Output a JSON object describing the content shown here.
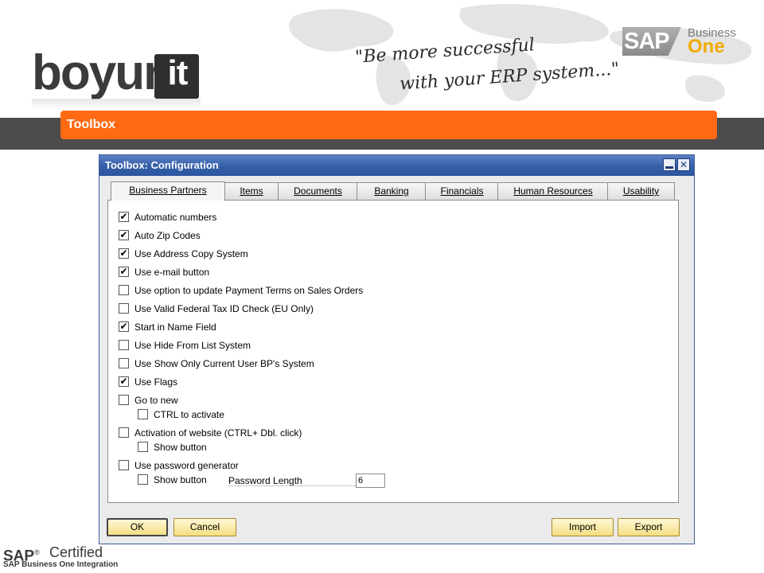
{
  "header": {
    "logo_word": "boyum",
    "logo_box": "it",
    "tagline_line1": "\"Be more successful",
    "tagline_line2": "with your ERP system...\"",
    "sap_badge": "SAP",
    "sap_business": "Business",
    "sap_one": "One"
  },
  "banner": {
    "title": "Toolbox"
  },
  "dialog": {
    "title": "Toolbox: Configuration",
    "tabs": [
      {
        "label": "Business Partners",
        "active": true
      },
      {
        "label": "Items",
        "active": false
      },
      {
        "label": "Documents",
        "active": false
      },
      {
        "label": "Banking",
        "active": false
      },
      {
        "label": "Financials",
        "active": false
      },
      {
        "label": "Human Resources",
        "active": false
      },
      {
        "label": "Usability",
        "active": false
      }
    ],
    "options": [
      {
        "label": "Automatic numbers",
        "checked": true
      },
      {
        "label": "Auto Zip Codes",
        "checked": true
      },
      {
        "label": "Use Address Copy System",
        "checked": true
      },
      {
        "label": "Use e-mail button",
        "checked": true
      },
      {
        "label": "Use option to update Payment Terms on Sales Orders",
        "checked": false
      },
      {
        "label": "Use Valid Federal Tax ID Check (EU Only)",
        "checked": false
      },
      {
        "label": "Start in Name Field",
        "checked": true
      },
      {
        "label": "Use Hide From List System",
        "checked": false
      },
      {
        "label": "Use Show Only Current User BP's System",
        "checked": false
      },
      {
        "label": "Use Flags",
        "checked": true
      },
      {
        "label": "Go to new",
        "checked": false
      },
      {
        "label": "CTRL to activate",
        "checked": false
      },
      {
        "label": "Activation of website (CTRL+ Dbl. click)",
        "checked": false
      },
      {
        "label": "Show button",
        "checked": false
      },
      {
        "label": "Use password generator",
        "checked": false
      },
      {
        "label": "Show button",
        "checked": false
      }
    ],
    "password_length": {
      "label": "Password Length",
      "value": "6"
    },
    "buttons": {
      "ok": "OK",
      "cancel": "Cancel",
      "import": "Import",
      "export": "Export"
    }
  },
  "footer": {
    "sap": "SAP",
    "reg": "®",
    "certified": "Certified",
    "sub": "SAP Business One Integration"
  },
  "colors": {
    "orange": "#ff6a13",
    "titlebar": "#355ea8",
    "button": "#f4de83"
  },
  "icons": {
    "minimize": "minimize-icon",
    "close": "close-icon",
    "check": "check-icon"
  }
}
